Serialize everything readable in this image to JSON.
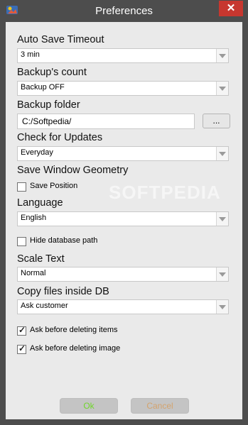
{
  "window": {
    "title": "Preferences",
    "close_glyph": "✕",
    "app_icon": "app-icon"
  },
  "watermark": "SOFTPEDIA",
  "auto_save": {
    "label": "Auto Save Timeout",
    "value": "3 min"
  },
  "backups_count": {
    "label": "Backup's count",
    "value": "Backup OFF"
  },
  "backup_folder": {
    "label": "Backup folder",
    "value": "C:/Softpedia/",
    "browse_label": "..."
  },
  "updates": {
    "label": "Check for Updates",
    "value": "Everyday"
  },
  "window_geometry": {
    "label": "Save Window Geometry",
    "save_position_label": "Save Position",
    "save_position_checked": false
  },
  "language": {
    "label": "Language",
    "value": "English"
  },
  "hide_db_path": {
    "label": "Hide database path",
    "checked": false
  },
  "scale_text": {
    "label": "Scale Text",
    "value": "Normal"
  },
  "copy_files": {
    "label": "Copy files inside DB",
    "value": "Ask customer"
  },
  "ask_delete_items": {
    "label": "Ask before deleting items",
    "checked": true
  },
  "ask_delete_image": {
    "label": "Ask before deleting image",
    "checked": true
  },
  "buttons": {
    "ok_label": "Ok",
    "cancel_label": "Cancel"
  },
  "colors": {
    "titlebar": "#4d4d4d",
    "client": "#eaeaea",
    "close": "#c7372f",
    "ok_text": "#70d62b",
    "cancel_text": "#d4a36d"
  }
}
